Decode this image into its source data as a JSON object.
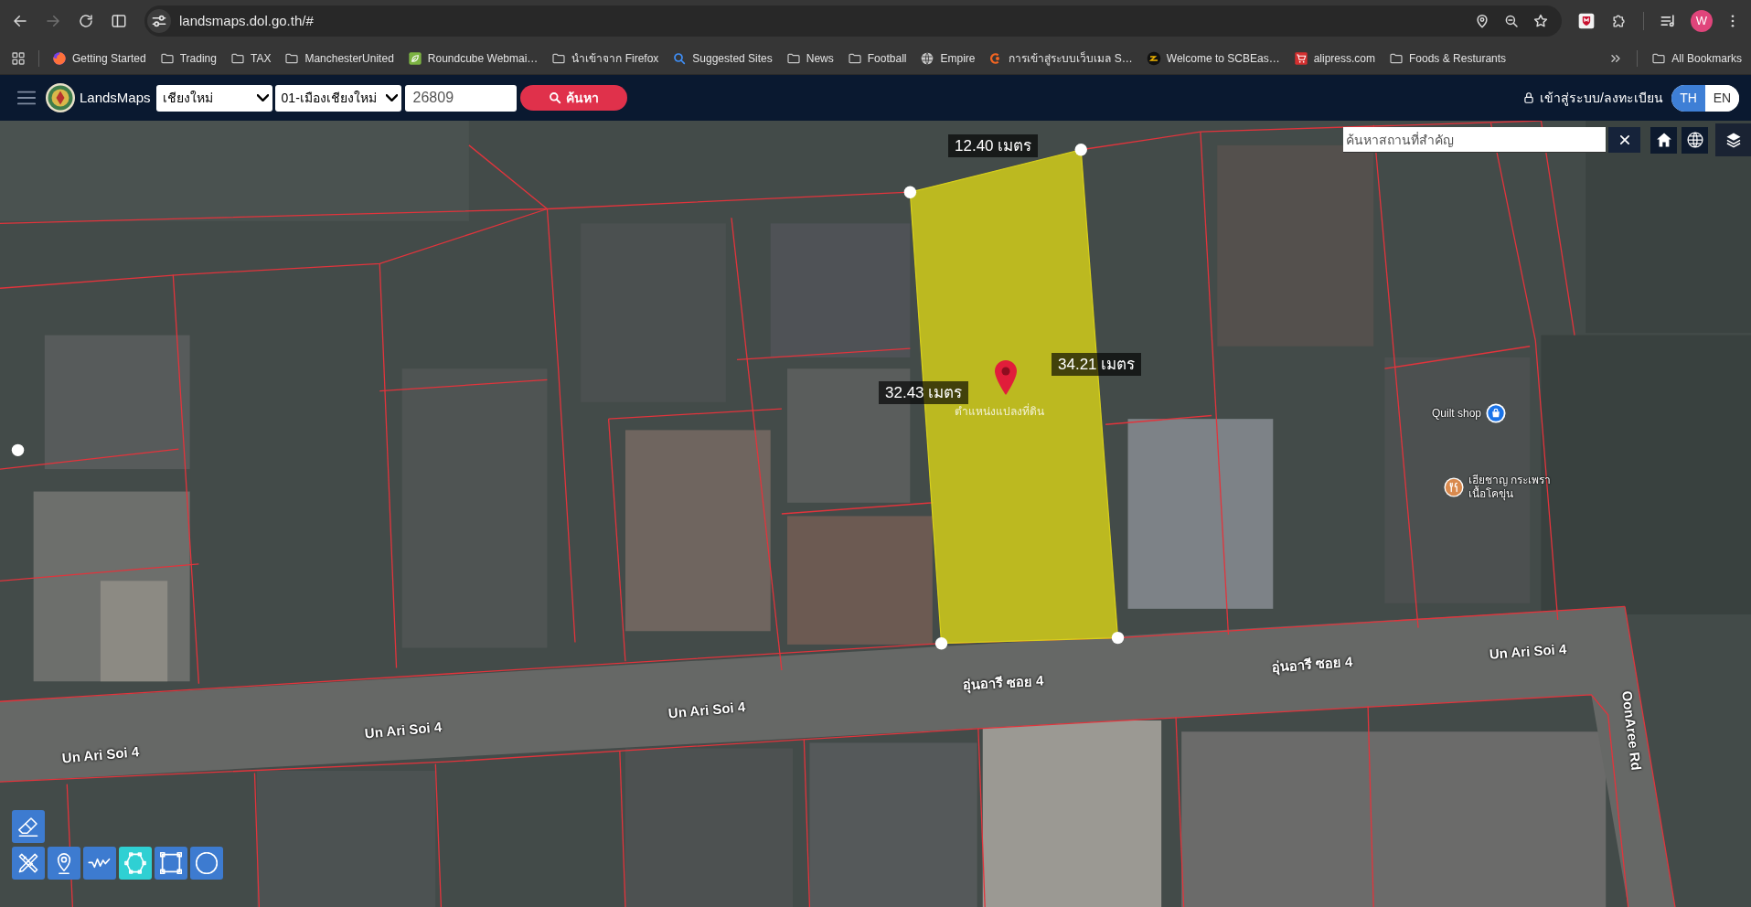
{
  "browser": {
    "nav_buttons": [
      {
        "kind": "back",
        "disabled": false
      },
      {
        "kind": "forward",
        "disabled": true
      },
      {
        "kind": "reload",
        "disabled": false
      },
      {
        "kind": "split_view",
        "disabled": false
      }
    ],
    "address": "landsmaps.dol.go.th/#",
    "profile_initial": "W"
  },
  "bookmarks_bar": {
    "items": [
      {
        "label": "Getting Started",
        "kind": "app_logo"
      },
      {
        "label": "Trading",
        "kind": "folder"
      },
      {
        "label": "TAX",
        "kind": "folder"
      },
      {
        "label": "ManchesterUnited",
        "kind": "folder"
      },
      {
        "label": "Roundcube Webmai…",
        "kind": "leaf"
      },
      {
        "label": "นำเข้าจาก Firefox",
        "kind": "folder"
      },
      {
        "label": "Suggested Sites",
        "kind": "search"
      },
      {
        "label": "News",
        "kind": "folder"
      },
      {
        "label": "Football",
        "kind": "folder"
      },
      {
        "label": "Empire",
        "kind": "globe"
      },
      {
        "label": "การเข้าสู่ระบบเว็บเมล S…",
        "kind": "swirl"
      },
      {
        "label": "Welcome to SCBEas…",
        "kind": "stripes"
      },
      {
        "label": "alipress.com",
        "kind": "cart"
      },
      {
        "label": "Foods & Resturants",
        "kind": "folder"
      }
    ],
    "all_bookmarks": "All Bookmarks"
  },
  "header": {
    "brand": "LandsMaps",
    "province": "เชียงใหม่",
    "district": "01-เมืองเชียงใหม่",
    "parcel_number": "26809",
    "search_button": "ค้นหา",
    "login": "เข้าสู่ระบบ/ลงทะเบียน",
    "languages": [
      {
        "label": "TH",
        "selected": true
      },
      {
        "label": "EN",
        "selected": false
      }
    ]
  },
  "map": {
    "place_search": {
      "placeholder": "ค้นหาสถานที่สำคัญ"
    },
    "measurements": [
      "12.40 เมตร",
      "34.21 เมตร",
      "32.43 เมตร"
    ],
    "parcel_label": "ตำแหน่งแปลงที่ดิน",
    "places": [
      {
        "kind": "shop",
        "lines": [
          "Quilt shop"
        ]
      },
      {
        "kind": "restaurant",
        "lines": [
          "เฮียชาญ กระเพรา",
          "เนื้อโคขุ่น"
        ]
      }
    ],
    "roads": [
      "Un Ari Soi 4",
      "อุ่นอารี ซอย 4",
      "อุ่นอารี ซอย 4",
      "Un Ari Soi 4",
      "OonAree Rd",
      "Un Ari Soi 4",
      "Un Ari Soi 4"
    ],
    "tool_rows": [
      [
        {
          "kind": "erase",
          "selected": false
        }
      ],
      [
        {
          "kind": "measure",
          "selected": false
        },
        {
          "kind": "point",
          "selected": false
        },
        {
          "kind": "line",
          "selected": false
        },
        {
          "kind": "polygon",
          "selected": true
        },
        {
          "kind": "rectangle",
          "selected": false
        },
        {
          "kind": "circle",
          "selected": false
        }
      ]
    ]
  }
}
